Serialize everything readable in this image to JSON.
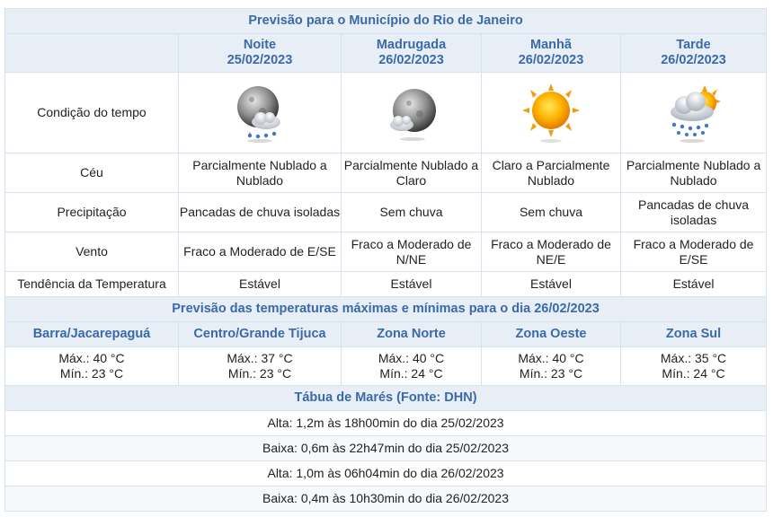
{
  "title": "Previsão para o Município do Rio de Janeiro",
  "periods": [
    {
      "name": "Noite",
      "date": "25/02/2023",
      "icon": "moon-cloud-rain-icon",
      "sky": "Parcialmente  Nublado a Nublado",
      "precip": "Pancadas  de chuva isoladas",
      "wind": "Fraco a Moderado de E/SE",
      "trend": "Estável"
    },
    {
      "name": "Madrugada",
      "date": "26/02/2023",
      "icon": "moon-cloud-icon",
      "sky": "Parcialmente  Nublado a Claro",
      "precip": "Sem  chuva",
      "wind": "Fraco a Moderado de N/NE",
      "trend": "Estável"
    },
    {
      "name": "Manhã",
      "date": "26/02/2023",
      "icon": "sun-icon",
      "sky": "Claro a Parcialmente Nublado",
      "precip": "Sem  chuva",
      "wind": "Fraco a Moderado de NE/E",
      "trend": "Estável"
    },
    {
      "name": "Tarde",
      "date": "26/02/2023",
      "icon": "sun-cloud-rain-icon",
      "sky": "Parcialmente  Nublado a Nublado",
      "precip": "Pancadas  de chuva isoladas",
      "wind": "Fraco a Moderado de E/SE",
      "trend": "Estável"
    }
  ],
  "row_labels": {
    "condition": "Condição do tempo",
    "sky": "Céu",
    "precip": "Precipitação",
    "wind": "Vento",
    "trend": "Tendência da Temperatura"
  },
  "temps_title": "Previsão das temperaturas  máximas  e mínimas  para o dia 26/02/2023",
  "zones": [
    {
      "name": "Barra/Jacarepaguá",
      "max": "Máx.: 40 °C",
      "min": "Mín.: 23 °C"
    },
    {
      "name": "Centro/Grande Tijuca",
      "max": "Máx.: 37 °C",
      "min": "Mín.: 23 °C"
    },
    {
      "name": "Zona Norte",
      "max": "Máx.: 40 °C",
      "min": "Mín.: 24 °C"
    },
    {
      "name": "Zona Oeste",
      "max": "Máx.: 40 °C",
      "min": "Mín.: 23 °C"
    },
    {
      "name": "Zona Sul",
      "max": "Máx.: 35 °C",
      "min": "Mín.: 24 °C"
    }
  ],
  "tides_title": "Tábua de Marés (Fonte: DHN)",
  "tides": [
    "Alta:  1,2m às 18h00min do dia 25/02/2023",
    "Baixa:  0,6m às 22h47min do dia 25/02/2023",
    "Alta:  1,0m às 06h04min do dia 26/02/2023",
    "Baixa:  0,4m às 10h30min do dia 26/02/2023"
  ],
  "colors": {
    "header_bg": "#e8eef6",
    "header_text": "#3b6aa8",
    "border": "#d7e2ef"
  }
}
